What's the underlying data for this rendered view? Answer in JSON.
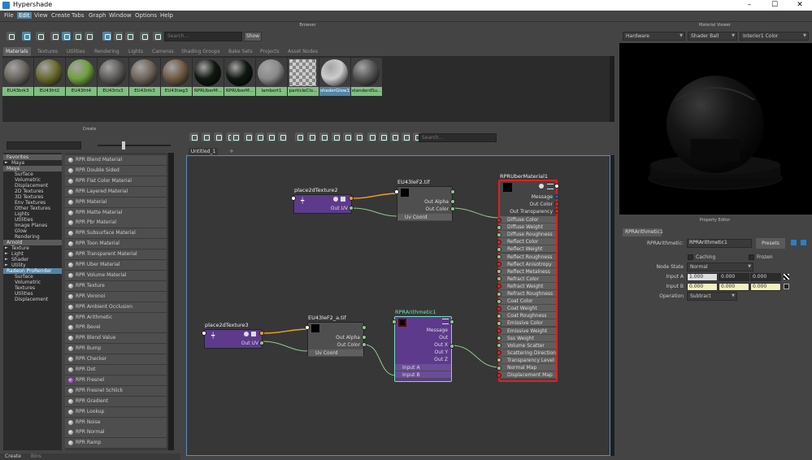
{
  "window": {
    "title": "Hypershade",
    "minimize": "–",
    "maximize": "☐",
    "close": "✕"
  },
  "menu": [
    "File",
    "Edit",
    "View",
    "Create",
    "Tabs",
    "Graph",
    "Window",
    "Options",
    "Help"
  ],
  "browser": {
    "title": "Browser",
    "search_placeholder": "Search...",
    "show_label": "Show",
    "tabs": [
      "Materials",
      "Textures",
      "Utilities",
      "Rendering",
      "Lights",
      "Cameras",
      "Shading Groups",
      "Bake Sets",
      "Projects",
      "Asset Nodes"
    ],
    "swatches": [
      {
        "label": "EU43brk3",
        "color": "#6b6660"
      },
      {
        "label": "EU43frt2",
        "color": "#6a6a30"
      },
      {
        "label": "EU43frt4",
        "color": "#70a040"
      },
      {
        "label": "EU43rts3",
        "color": "#5e5c58"
      },
      {
        "label": "EU43rtk3",
        "color": "#70655a"
      },
      {
        "label": "EU43twg3",
        "color": "#705a45"
      },
      {
        "label": "RPRUberM...",
        "color": "#101810"
      },
      {
        "label": "RPRUberM...",
        "color": "#101810"
      },
      {
        "label": "lambert1",
        "color": "#8a8a8a"
      },
      {
        "label": "particleClo...",
        "color": "#3aa6b0"
      },
      {
        "label": "shaderGlow1",
        "color": "#cccccc"
      },
      {
        "label": "standardSu...",
        "color": "#555555"
      }
    ]
  },
  "material_viewer": {
    "title": "Material Viewer",
    "renderer": "Hardware",
    "shape": "Shader Ball",
    "env": "Interior1 Color"
  },
  "property_editor": {
    "title": "Property Editor",
    "tab": "RPRArithmetic1",
    "name_label": "RPRArithmetic:",
    "name_value": "RPRArithmetic1",
    "presets": "Presets",
    "caching": "Caching",
    "frozen": "Frozen",
    "node_state_label": "Node State",
    "node_state": "Normal",
    "input_a_label": "Input A",
    "input_a": [
      "1.000",
      "0.000",
      "0.000"
    ],
    "input_b_label": "Input B",
    "input_b": [
      "0.000",
      "0.000",
      "0.000"
    ],
    "operation_label": "Operation",
    "operation": "Subtract"
  },
  "create": {
    "title": "Create",
    "categories": [
      {
        "label": "Favorites",
        "type": "hdr"
      },
      {
        "label": "Maya",
        "type": "sub",
        "arrow": "►"
      },
      {
        "label": "Maya",
        "type": "hdr"
      },
      {
        "label": "Surface"
      },
      {
        "label": "Volumetric"
      },
      {
        "label": "Displacement"
      },
      {
        "label": "2D Textures"
      },
      {
        "label": "3D Textures"
      },
      {
        "label": "Env Textures"
      },
      {
        "label": "Other Textures"
      },
      {
        "label": "Lights"
      },
      {
        "label": "Utilities"
      },
      {
        "label": "Image Planes"
      },
      {
        "label": "Glow"
      },
      {
        "label": "Rendering"
      },
      {
        "label": "Arnold",
        "type": "hdr"
      },
      {
        "label": "Texture",
        "type": "sub",
        "arrow": "►"
      },
      {
        "label": "Light",
        "type": "sub",
        "arrow": "►"
      },
      {
        "label": "Shader",
        "type": "sub",
        "arrow": "►"
      },
      {
        "label": "Utility",
        "type": "sub",
        "arrow": "►"
      },
      {
        "label": "Radeon ProRender",
        "type": "hdr sel"
      },
      {
        "label": "Surface"
      },
      {
        "label": "Volumetric"
      },
      {
        "label": "Textures"
      },
      {
        "label": "Utilities"
      },
      {
        "label": "Displacement"
      }
    ],
    "nodes": [
      {
        "label": "RPR Blend Material"
      },
      {
        "label": "RPR Double Sided"
      },
      {
        "label": "RPR Flat Color Material"
      },
      {
        "label": "RPR Layered Material"
      },
      {
        "label": "RPR Material"
      },
      {
        "label": "RPR Matte Material"
      },
      {
        "label": "RPR Pbr Material"
      },
      {
        "label": "RPR Subsurface Material"
      },
      {
        "label": "RPR Toon Material"
      },
      {
        "label": "RPR Transparent Material"
      },
      {
        "label": "RPR Uber Material"
      },
      {
        "label": "RPR Volume Material"
      },
      {
        "label": "RPR Texture"
      },
      {
        "label": "RPR Voronoi"
      },
      {
        "label": "RPR Ambient Occlusion"
      },
      {
        "label": "RPR Arithmetic"
      },
      {
        "label": "RPR Bevel"
      },
      {
        "label": "RPR Blend Value"
      },
      {
        "label": "RPR Bump"
      },
      {
        "label": "RPR Checker"
      },
      {
        "label": "RPR Dot"
      },
      {
        "label": "RPR Fresnel",
        "purple": true
      },
      {
        "label": "RPR Fresnel Schlick"
      },
      {
        "label": "RPR Gradient"
      },
      {
        "label": "RPR Lookup"
      },
      {
        "label": "RPR Noise"
      },
      {
        "label": "RPR Normal"
      },
      {
        "label": "RPR Ramp"
      }
    ]
  },
  "bottom_tabs": [
    "Create",
    "Bins"
  ],
  "graph": {
    "tab": "Untitled_1",
    "add_tab": "+",
    "search_placeholder": "Search...",
    "nodes": {
      "p2d2": {
        "title": "place2dTexture2",
        "out": "Out UV"
      },
      "eu2": {
        "title": "EU43leF2.tif",
        "out_alpha": "Out Alpha",
        "out_color": "Out Color",
        "uv": "Uv Coord"
      },
      "p2d3": {
        "title": "place2dTexture3",
        "out": "Out UV"
      },
      "eu2a": {
        "title": "EU43leF2_a.tif",
        "out_alpha": "Out Alpha",
        "out_color": "Out Color",
        "uv": "Uv Coord"
      },
      "arith": {
        "title": "RPRArithmetic1",
        "rows": [
          "Message",
          "Out",
          "Out X",
          "Out Y",
          "Out Z"
        ],
        "inputs": [
          "Input A",
          "Input B"
        ]
      },
      "uber": {
        "title": "RPRUberMaterial1",
        "rows": [
          "Message",
          "Out Color",
          "Out Transparency"
        ],
        "inputs": [
          "Diffuse Color",
          "Diffuse Weight",
          "Diffuse Roughness",
          "Reflect Color",
          "Reflect Weight",
          "Reflect Roughness",
          "Reflect Anisotropy",
          "Reflect Metalness",
          "Refract Color",
          "Refract Weight",
          "Refract Roughness",
          "Coat Color",
          "Coat Weight",
          "Coat Roughness",
          "Emissive Color",
          "Emissive Weight",
          "Sss Weight",
          "Volume Scatter",
          "Scattering Direction",
          "Transparency Level",
          "Normal Map",
          "Displacement Map"
        ]
      }
    }
  }
}
